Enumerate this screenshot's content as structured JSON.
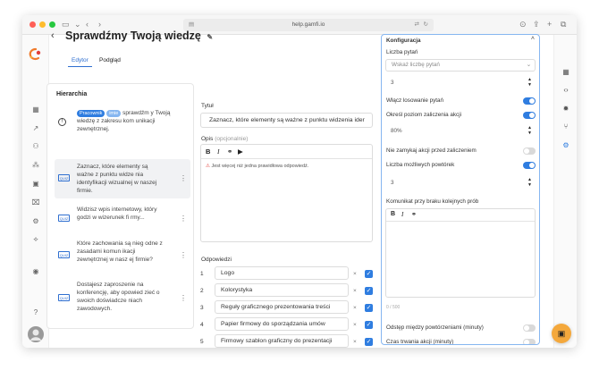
{
  "browser": {
    "url": "help.gamfi.io",
    "colors": {
      "close": "#ff5f57",
      "minimize": "#febc2e",
      "maximize": "#28c840"
    }
  },
  "page": {
    "title": "Sprawdźmy Twoją wiedzę",
    "tabs": [
      {
        "label": "Edytor",
        "active": true
      },
      {
        "label": "Podgląd",
        "active": false
      }
    ]
  },
  "hierarchy": {
    "title": "Hierarchia",
    "intro": {
      "pill1": "Pracownik",
      "pill2": "imie",
      "text": "sprawdźm y Twoją wiedzę z zakresu kom unikacji zewnętrznej."
    },
    "items": [
      {
        "icon_label": "QUIZ",
        "text": "Zaznacz, które elementy są ważne z punktu widze nia identyfikacji wizualnej w naszej firmie.",
        "selected": true
      },
      {
        "icon_label": "QUIZ",
        "text": "Widzisz wpis internetowy, który godzi w wizerunek fi rmy...",
        "selected": false
      },
      {
        "icon_label": "QUIZ",
        "text": "Które zachowania są nieg odne z zasadami komun ikacji zewnętrznej w nasz ej firmie?",
        "selected": false
      },
      {
        "icon_label": "QUIZ",
        "text": "Dostajesz zaproszenie na konferencję, aby opowied zieć o swoich doświadcze niach zawodowych.",
        "selected": false
      }
    ]
  },
  "editor": {
    "title_label": "Tytuł",
    "title_value": "Zaznacz, które elementy są ważne z punktu widzenia ider",
    "desc_label": "Opis",
    "desc_optional": "(opcjonalnie)",
    "desc_hint": "Jest więcej niż jedna prawidłowa odpowiedź.",
    "answers_label": "Odpowiedzi",
    "answers": [
      {
        "num": "1",
        "text": "Logo"
      },
      {
        "num": "2",
        "text": "Kolorystyka"
      },
      {
        "num": "3",
        "text": "Reguły graficznego prezentowania treści"
      },
      {
        "num": "4",
        "text": "Papier firmowy do sporządzania umów"
      },
      {
        "num": "5",
        "text": "Firmowy szablon graficzny do prezentacji"
      }
    ]
  },
  "config": {
    "title": "Konfiguracja",
    "questions_label": "Liczba pytań",
    "questions_placeholder": "Wskaż liczbę pytań",
    "questions_value": "3",
    "shuffle_label": "Włącz losowanie pytań",
    "shuffle_on": true,
    "pass_level_label": "Określ poziom zaliczenia akcji",
    "pass_level_on": true,
    "pass_level_value": "80%",
    "no_close_label": "Nie zamykaj akcji przed zaliczeniem",
    "no_close_on": false,
    "retries_label": "Liczba możliwych powtórek",
    "retries_on": true,
    "retries_value": "3",
    "no_attempts_label": "Komunikat przy braku kolejnych prób",
    "char_count": "0 / 500",
    "interval_label": "Odstęp między powtórzeniami (minuty)",
    "interval_on": false,
    "duration_label": "Czas trwania akcji (minuty)",
    "duration_on": false,
    "accent": "#2f7de0"
  }
}
